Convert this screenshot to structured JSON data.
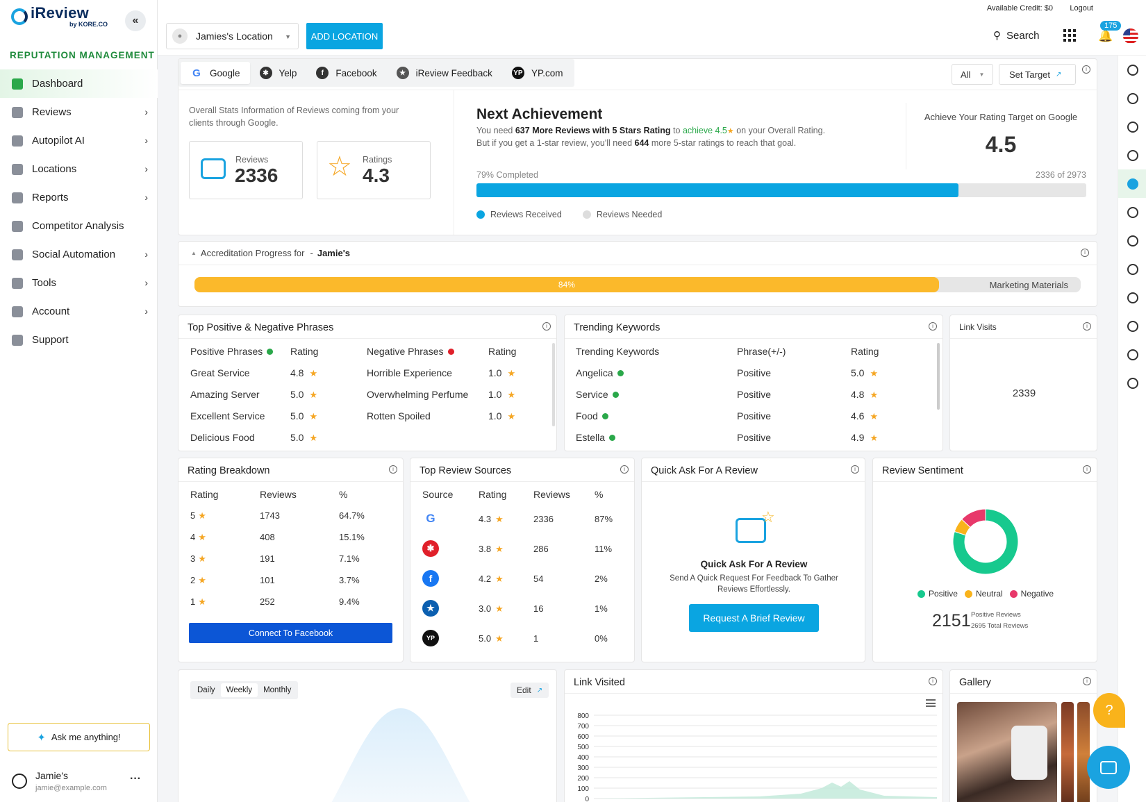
{
  "app": {
    "logo_title": "iReview",
    "logo_sub": "by KORE.CO",
    "section_title": "REPUTATION MANAGEMENT"
  },
  "nav": [
    {
      "label": "Dashboard",
      "chevron": false
    },
    {
      "label": "Reviews",
      "chevron": true
    },
    {
      "label": "Autopilot AI",
      "chevron": true
    },
    {
      "label": "Locations",
      "chevron": true
    },
    {
      "label": "Reports",
      "chevron": true
    },
    {
      "label": "Competitor Analysis",
      "chevron": false
    },
    {
      "label": "Social Automation",
      "chevron": true
    },
    {
      "label": "Tools",
      "chevron": true
    },
    {
      "label": "Account",
      "chevron": true
    },
    {
      "label": "Support",
      "chevron": false
    }
  ],
  "ask_label": "Ask me anything!",
  "user": {
    "name": "Jamie's",
    "email": "jamie@example.com"
  },
  "topline": {
    "credit": "Available Credit: $0",
    "logout": "Logout"
  },
  "header": {
    "location": "Jamies's Location",
    "add_location": "ADD LOCATION",
    "search": "Search",
    "notif_count": "175"
  },
  "sources": [
    "Google",
    "Yelp",
    "Facebook",
    "iReview Feedback",
    "YP.com"
  ],
  "filter": {
    "all": "All",
    "set_target": "Set Target"
  },
  "overall": {
    "desc": "Overall Stats Information of Reviews coming from your clients through Google.",
    "reviews_label": "Reviews",
    "reviews_value": "2336",
    "ratings_label": "Ratings",
    "ratings_value": "4.3"
  },
  "achievement": {
    "title": "Next Achievement",
    "l1a": "You need ",
    "l1b": "637 More Reviews with 5 Stars Rating",
    "l1c": " to ",
    "l1d": "achieve 4.5",
    "l1e": " on your Overall Rating.",
    "l2a": "But if you get a 1-star review, you'll need ",
    "l2b": "644",
    "l2c": " more 5-star ratings to reach that goal.",
    "completed": "79% Completed",
    "count": "2336 of 2973",
    "progress": 0.79,
    "legend_received": "Reviews Received",
    "legend_needed": "Reviews Needed",
    "target_label": "Achieve Your Rating Target on Google",
    "target_value": "4.5"
  },
  "accreditation": {
    "label": "Accreditation Progress for",
    "dash": "-",
    "name": "Jamie's",
    "percent_text": "84%",
    "progress": 0.84,
    "materials": "Marketing Materials"
  },
  "phrases": {
    "title": "Top Positive & Negative Phrases",
    "pos_header": "Positive Phrases",
    "neg_header": "Negative Phrases",
    "rating_header": "Rating",
    "positive": [
      [
        "Great Service",
        "4.8"
      ],
      [
        "Amazing Server",
        "5.0"
      ],
      [
        "Excellent Service",
        "5.0"
      ],
      [
        "Delicious Food",
        "5.0"
      ]
    ],
    "negative": [
      [
        "Horrible Experience",
        "1.0"
      ],
      [
        "Overwhelming Perfume",
        "1.0"
      ],
      [
        "Rotten Spoiled",
        "1.0"
      ]
    ]
  },
  "trending": {
    "title": "Trending Keywords",
    "headers": [
      "Trending Keywords",
      "Phrase(+/-)",
      "Rating"
    ],
    "rows": [
      [
        "Angelica",
        "Positive",
        "5.0"
      ],
      [
        "Service",
        "Positive",
        "4.8"
      ],
      [
        "Food",
        "Positive",
        "4.6"
      ],
      [
        "Estella",
        "Positive",
        "4.9"
      ]
    ]
  },
  "link_visits": {
    "title": "Link Visits",
    "value": "2339"
  },
  "rating_breakdown": {
    "title": "Rating Breakdown",
    "headers": [
      "Rating",
      "Reviews",
      "%"
    ],
    "rows": [
      [
        "5",
        "1743",
        "64.7%"
      ],
      [
        "4",
        "408",
        "15.1%"
      ],
      [
        "3",
        "191",
        "7.1%"
      ],
      [
        "2",
        "101",
        "3.7%"
      ],
      [
        "1",
        "252",
        "9.4%"
      ]
    ],
    "button": "Connect To Facebook"
  },
  "top_sources": {
    "title": "Top Review Sources",
    "headers": [
      "Source",
      "Rating",
      "Reviews",
      "%"
    ],
    "rows": [
      {
        "icon": "google-icon",
        "rating": "4.3",
        "reviews": "2336",
        "pct": "87%"
      },
      {
        "icon": "yelp-icon",
        "rating": "3.8",
        "reviews": "286",
        "pct": "11%"
      },
      {
        "icon": "facebook-icon",
        "rating": "4.2",
        "reviews": "54",
        "pct": "2%"
      },
      {
        "icon": "ireview-icon",
        "rating": "3.0",
        "reviews": "16",
        "pct": "1%"
      },
      {
        "icon": "yp-icon",
        "rating": "5.0",
        "reviews": "1",
        "pct": "0%"
      }
    ]
  },
  "quick_ask": {
    "title": "Quick Ask For A Review",
    "heading": "Quick Ask For A Review",
    "desc1": "Send A Quick Request For Feedback To Gather",
    "desc2": "Reviews Effortlessly.",
    "button": "Request A Brief Review"
  },
  "sentiment": {
    "title": "Review Sentiment",
    "legend": [
      "Positive",
      "Neutral",
      "Negative"
    ],
    "values": [
      80,
      7,
      13
    ],
    "colors": [
      "#17c98e",
      "#f9b31b",
      "#e8386a"
    ],
    "count": "2151",
    "positive_label": "Positive Reviews",
    "total_label": "2695 Total Reviews"
  },
  "period": {
    "tabs": [
      "Daily",
      "Weekly",
      "Monthly"
    ],
    "edit": "Edit"
  },
  "link_visited": {
    "title": "Link Visited",
    "yticks": [
      "800",
      "700",
      "600",
      "500",
      "400",
      "300",
      "200",
      "100",
      "0"
    ]
  },
  "gallery": {
    "title": "Gallery"
  },
  "help_label": "?"
}
